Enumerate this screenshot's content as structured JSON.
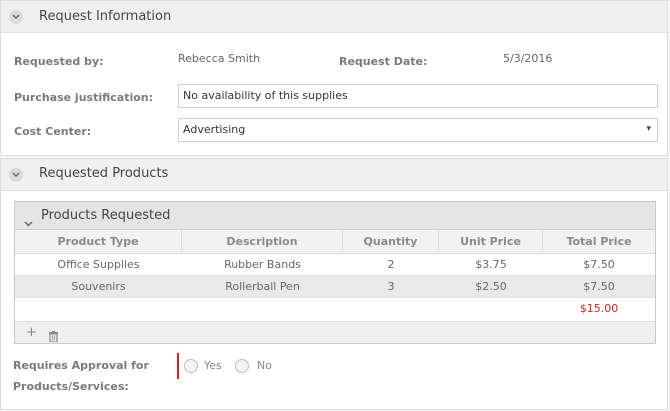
{
  "request_info": {
    "title": "Request Information",
    "requested_by_label": "Requested by:",
    "requested_by_value": "Rebecca Smith",
    "request_date_label": "Request Date:",
    "request_date_value": "5/3/2016",
    "justification_label": "Purchase justification:",
    "justification_value": "No availability of this supplies",
    "cost_center_label": "Cost Center:",
    "cost_center_value": "Advertising"
  },
  "requested_products": {
    "title": "Requested Products",
    "grid_title": "Products Requested",
    "columns": [
      "Product Type",
      "Description",
      "Quantity",
      "Unit Price",
      "Total Price"
    ],
    "rows": [
      [
        "Office Supplies",
        "Rubber Bands",
        "2",
        "$3.75",
        "$7.50"
      ],
      [
        "Souvenirs",
        "Rollerball Pen",
        "3",
        "$2.50",
        "$7.50"
      ]
    ],
    "grand_total": "$15.00",
    "approval_label_line1": "Requires Approval for",
    "approval_label_line2": "Products/Services:",
    "yes_label": "Yes",
    "no_label": "No"
  },
  "colors": {
    "accent_red": "#d22222",
    "header_bg": "#f0f0f0"
  }
}
